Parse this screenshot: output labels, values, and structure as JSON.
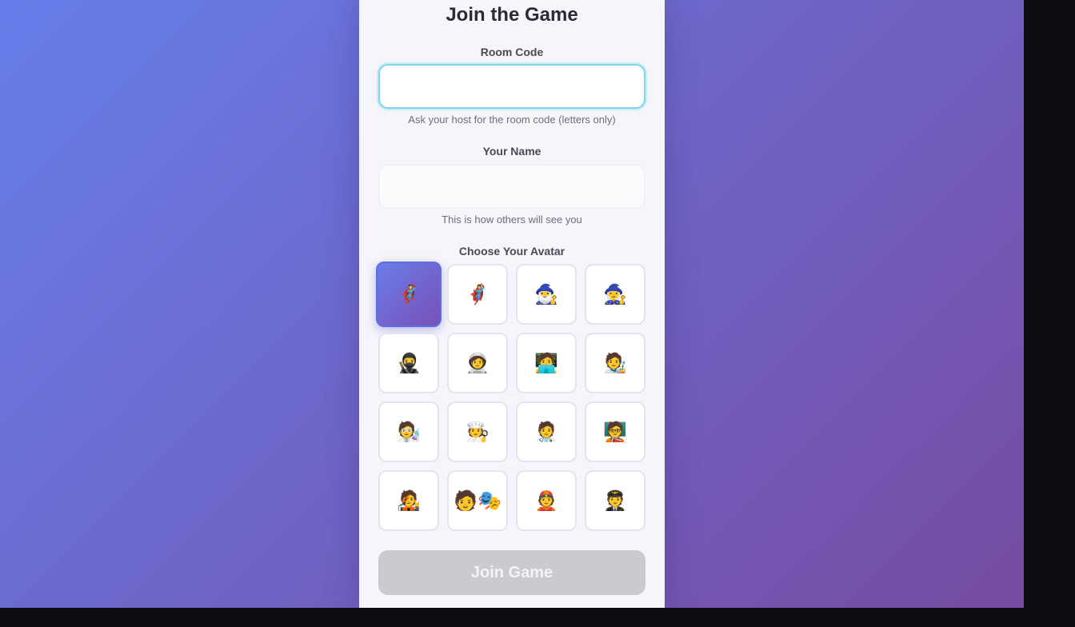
{
  "form": {
    "title": "Join the Game",
    "room_code": {
      "label": "Room Code",
      "value": "",
      "placeholder": "",
      "hint": "Ask your host for the room code (letters only)"
    },
    "name": {
      "label": "Your Name",
      "value": "",
      "placeholder": "",
      "hint": "This is how others will see you"
    },
    "avatar_section": {
      "label": "Choose Your Avatar",
      "selected_index": 0,
      "avatars": [
        {
          "emoji": "🦸",
          "name": "superhero"
        },
        {
          "emoji": "🦸‍♀️",
          "name": "superhero-woman"
        },
        {
          "emoji": "🧙‍♂️",
          "name": "wizard"
        },
        {
          "emoji": "🧙‍♀️",
          "name": "wizard-woman"
        },
        {
          "emoji": "🥷",
          "name": "ninja"
        },
        {
          "emoji": "🧑‍🚀",
          "name": "astronaut"
        },
        {
          "emoji": "🧑‍💻",
          "name": "technologist"
        },
        {
          "emoji": "🧑‍🎨",
          "name": "artist"
        },
        {
          "emoji": "🧑‍🔬",
          "name": "scientist"
        },
        {
          "emoji": "🧑‍🍳",
          "name": "cook"
        },
        {
          "emoji": "🧑‍⚕️",
          "name": "health-worker"
        },
        {
          "emoji": "🧑‍🏫",
          "name": "teacher"
        },
        {
          "emoji": "🧑‍🎤",
          "name": "singer"
        },
        {
          "emoji": "🧑🎭",
          "name": "performer"
        },
        {
          "emoji": "👲",
          "name": "firefighter"
        },
        {
          "emoji": "🧑‍✈️",
          "name": "pilot"
        }
      ]
    },
    "join_button": {
      "label": "Join Game",
      "disabled": true
    }
  },
  "colors": {
    "background_start": "#667eea",
    "background_end": "#764ba2",
    "card": "#f5f5fb",
    "focus_ring": "#7fd8ea",
    "disabled_button": "#cbcbcf"
  }
}
